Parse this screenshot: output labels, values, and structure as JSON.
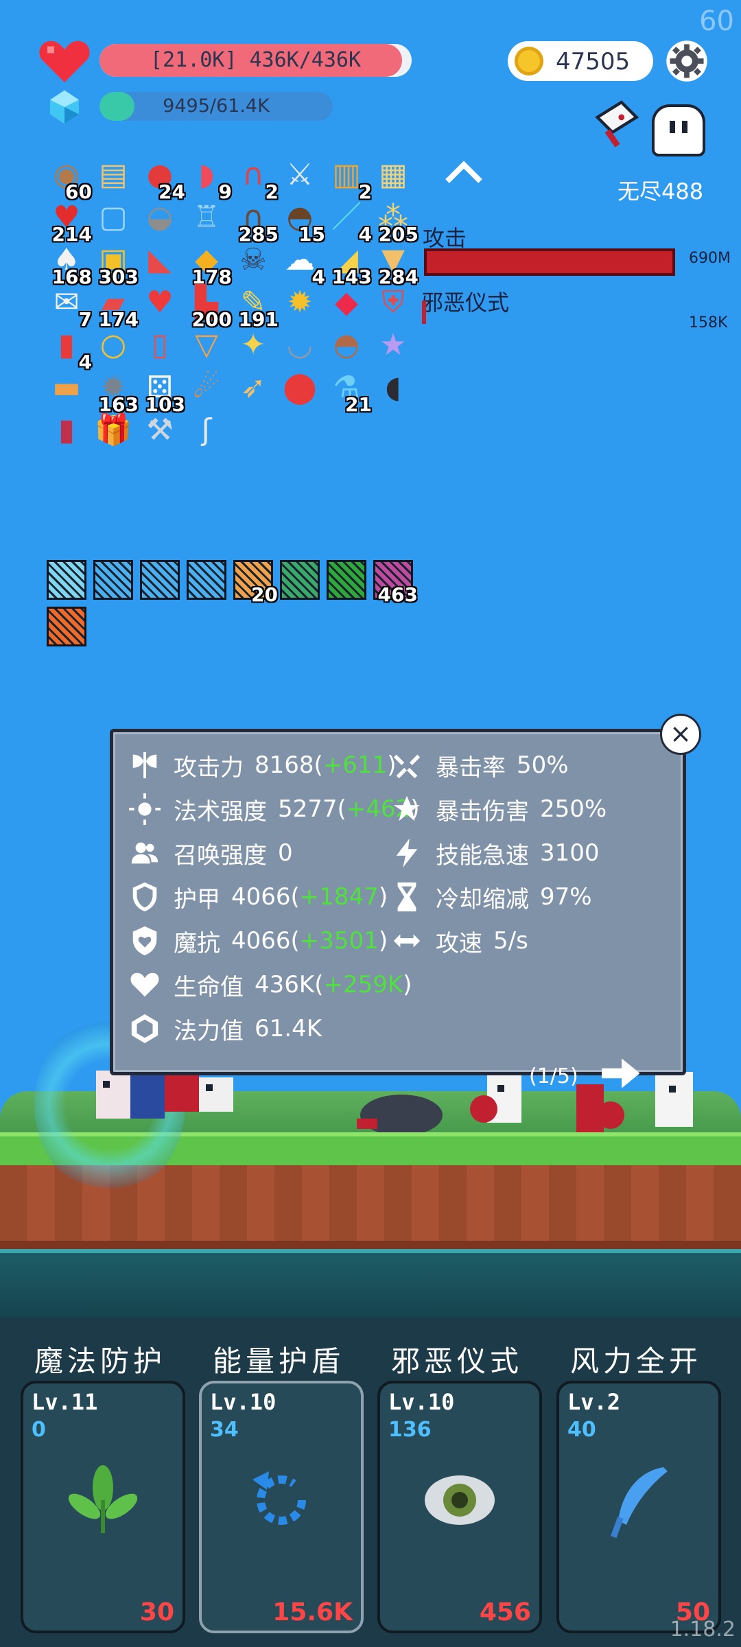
{
  "hud": {
    "fps": "60",
    "version": "1.18.2",
    "hp_text": "[21.0K] 436K/436K",
    "hp_fraction": 0.97,
    "mp_text": "9495/61.4K",
    "mp_fraction": 0.15,
    "gold": "47505",
    "stage": "无尽488"
  },
  "inventory": [
    {
      "name": "round-shield-item",
      "glyph": "◉",
      "color": "#b57a4a",
      "count": "60"
    },
    {
      "name": "scroll-item",
      "glyph": "▤",
      "color": "#f2c46a",
      "count": ""
    },
    {
      "name": "apple-item",
      "glyph": "●",
      "color": "#e33b3b",
      "count": "24"
    },
    {
      "name": "watermelon-item",
      "glyph": "◗",
      "color": "#ef4b5a",
      "count": "9"
    },
    {
      "name": "magnet-item",
      "glyph": "∩",
      "color": "#e0444a",
      "count": "2"
    },
    {
      "name": "sword-item",
      "glyph": "⚔",
      "color": "#dfe7ee",
      "count": ""
    },
    {
      "name": "book-item",
      "glyph": "▥",
      "color": "#f0a22f",
      "count": "2"
    },
    {
      "name": "map-item",
      "glyph": "▦",
      "color": "#f2d27a",
      "count": ""
    },
    {
      "name": "strawberry-item",
      "glyph": "♥",
      "color": "#e32c2c",
      "count": "214"
    },
    {
      "name": "empty-slot-item",
      "glyph": "▢",
      "color": "#9fd6f5",
      "count": ""
    },
    {
      "name": "helmet-item",
      "glyph": "◒",
      "color": "#8e8e8e",
      "count": ""
    },
    {
      "name": "shirt-item",
      "glyph": "♖",
      "color": "#9bd0f0",
      "count": ""
    },
    {
      "name": "tombstone-item",
      "glyph": "∩",
      "color": "#6a4a3a",
      "count": "285"
    },
    {
      "name": "coconut-item",
      "glyph": "◓",
      "color": "#6b4426",
      "count": "15"
    },
    {
      "name": "scalpel-item",
      "glyph": "／",
      "color": "#5fe0e0",
      "count": "4"
    },
    {
      "name": "grapes-item",
      "glyph": "⁂",
      "color": "#f0d070",
      "count": "205"
    },
    {
      "name": "cards-item",
      "glyph": "♠",
      "color": "#f2f2f2",
      "count": "168"
    },
    {
      "name": "toolbox-item",
      "glyph": "▣",
      "color": "#f4c02a",
      "count": "303"
    },
    {
      "name": "sneaker-item",
      "glyph": "◣",
      "color": "#e84a4a",
      "count": ""
    },
    {
      "name": "pineapple-item",
      "glyph": "◆",
      "color": "#f4b01e",
      "count": "178"
    },
    {
      "name": "skull-book-item",
      "glyph": "☠",
      "color": "#3a3f55",
      "count": ""
    },
    {
      "name": "ghost-item",
      "glyph": "☁",
      "color": "#ffffff",
      "count": "4"
    },
    {
      "name": "cheese-item",
      "glyph": "◢",
      "color": "#f6d24a",
      "count": "143"
    },
    {
      "name": "ice-cream-item",
      "glyph": "▼",
      "color": "#f2c06a",
      "count": "284"
    },
    {
      "name": "envelope-item",
      "glyph": "✉",
      "color": "#f2f2f2",
      "count": "7"
    },
    {
      "name": "pill-item",
      "glyph": "▰",
      "color": "#e84a4a",
      "count": "174"
    },
    {
      "name": "heart-item",
      "glyph": "♥",
      "color": "#ee3a3a",
      "count": ""
    },
    {
      "name": "boot-item",
      "glyph": "▙",
      "color": "#e83a3a",
      "count": "200"
    },
    {
      "name": "note-item",
      "glyph": "✎",
      "color": "#f6d24a",
      "count": "191"
    },
    {
      "name": "sun-item",
      "glyph": "✹",
      "color": "#f6c02a",
      "count": ""
    },
    {
      "name": "gem-item",
      "glyph": "◆",
      "color": "#ee2a4a",
      "count": ""
    },
    {
      "name": "crest-shield-item",
      "glyph": "⛨",
      "color": "#e84a4a",
      "count": ""
    },
    {
      "name": "bookmark-item",
      "glyph": "▮",
      "color": "#e83a3a",
      "count": "4"
    },
    {
      "name": "ring-item",
      "glyph": "○",
      "color": "#f6c02a",
      "count": ""
    },
    {
      "name": "thermometer-item",
      "glyph": "▯",
      "color": "#e85050",
      "count": ""
    },
    {
      "name": "cocktail-item",
      "glyph": "▽",
      "color": "#f2a04a",
      "count": ""
    },
    {
      "name": "magic-wand-item",
      "glyph": "✦",
      "color": "#f6d24a",
      "count": ""
    },
    {
      "name": "mortar-item",
      "glyph": "◡",
      "color": "#8e9aa6",
      "count": ""
    },
    {
      "name": "mushroom-item",
      "glyph": "◓",
      "color": "#b06a4a",
      "count": ""
    },
    {
      "name": "chest-item",
      "glyph": "★",
      "color": "#b89af0",
      "count": ""
    },
    {
      "name": "briefcase-item",
      "glyph": "▬",
      "color": "#f0a24a",
      "count": ""
    },
    {
      "name": "spiked-ball-item",
      "glyph": "✹",
      "color": "#7a8390",
      "count": "163"
    },
    {
      "name": "dice-item",
      "glyph": "⚄",
      "color": "#f2f2f2",
      "count": "103"
    },
    {
      "name": "meteor-item",
      "glyph": "☄",
      "color": "#f08a3a",
      "count": ""
    },
    {
      "name": "bow-item",
      "glyph": "➶",
      "color": "#f2c06a",
      "count": ""
    },
    {
      "name": "map-pin-item",
      "glyph": "⬤",
      "color": "#e83a3a",
      "count": ""
    },
    {
      "name": "potion-item",
      "glyph": "⚗",
      "color": "#6fd0f6",
      "count": "21"
    },
    {
      "name": "cauldron-item",
      "glyph": "◖",
      "color": "#2b2b33",
      "count": ""
    },
    {
      "name": "jam-jar-item",
      "glyph": "▮",
      "color": "#c0304a",
      "count": ""
    },
    {
      "name": "gift-item",
      "glyph": "🎁",
      "color": "#e83a3a",
      "count": ""
    },
    {
      "name": "battle-axe-item",
      "glyph": "⚒",
      "color": "#cfd6de",
      "count": ""
    },
    {
      "name": "hook-item",
      "glyph": "ʃ",
      "color": "#e8e8e8",
      "count": ""
    }
  ],
  "enemy": {
    "attack_label": "攻击",
    "attack_value": "690M",
    "ritual_label": "邪恶仪式",
    "ritual_value": "158K"
  },
  "runes": [
    {
      "name": "lightbulb-rune",
      "color": "#7fd6f0",
      "count": ""
    },
    {
      "name": "vortex-rune-1",
      "color": "#4ab0f0",
      "count": ""
    },
    {
      "name": "vortex-rune-2",
      "color": "#4ab0f0",
      "count": ""
    },
    {
      "name": "vortex-rune-3",
      "color": "#4ab0f0",
      "count": ""
    },
    {
      "name": "chest-rune",
      "color": "#f0a24a",
      "count": "20"
    },
    {
      "name": "invader-rune",
      "color": "#3aaa6a",
      "count": ""
    },
    {
      "name": "maze-rune",
      "color": "#2ea83a",
      "count": ""
    },
    {
      "name": "crown-rune",
      "color": "#c04aa0",
      "count": "463"
    },
    {
      "name": "fire-rune",
      "color": "#f06a2a",
      "count": ""
    }
  ],
  "stats_panel": {
    "close": "×",
    "left": [
      {
        "name": "attack-power",
        "icon": "axe-icon",
        "label": "攻击力",
        "value": "8168",
        "bonus": "+611"
      },
      {
        "name": "spell-power",
        "icon": "sun-icon",
        "label": "法术强度",
        "value": "5277",
        "bonus": "+462"
      },
      {
        "name": "summon-power",
        "icon": "people-icon",
        "label": "召唤强度",
        "value": "0",
        "bonus": ""
      },
      {
        "name": "armor",
        "icon": "shield-icon",
        "label": "护甲",
        "value": "4066",
        "bonus": "+1847"
      },
      {
        "name": "magic-resist",
        "icon": "heart-shield-icon",
        "label": "魔抗",
        "value": "4066",
        "bonus": "+3501"
      },
      {
        "name": "health",
        "icon": "heart-icon",
        "label": "生命值",
        "value": "436K",
        "bonus": "+259K"
      },
      {
        "name": "mana",
        "icon": "hexagon-icon",
        "label": "法力值",
        "value": "61.4K",
        "bonus": ""
      }
    ],
    "right": [
      {
        "name": "crit-rate",
        "icon": "crit-icon",
        "label": "暴击率",
        "value": "50%"
      },
      {
        "name": "crit-damage",
        "icon": "crit-damage-icon",
        "label": "暴击伤害",
        "value": "250%"
      },
      {
        "name": "skill-haste",
        "icon": "lightning-icon",
        "label": "技能急速",
        "value": "3100"
      },
      {
        "name": "cooldown-reduction",
        "icon": "hourglass-icon",
        "label": "冷却缩减",
        "value": "97%"
      },
      {
        "name": "attack-speed",
        "icon": "arrows-icon",
        "label": "攻速",
        "value": "5/s"
      }
    ],
    "page": "(1/5)"
  },
  "skills": [
    {
      "name": "magic-protection",
      "title": "魔法防护",
      "level": "Lv.11",
      "value": "0",
      "cost": "30",
      "icon": "leaf-icon",
      "selected": false
    },
    {
      "name": "energy-shield",
      "title": "能量护盾",
      "level": "Lv.10",
      "value": "34",
      "cost": "15.6K",
      "icon": "refresh-icon",
      "selected": true
    },
    {
      "name": "evil-ritual",
      "title": "邪恶仪式",
      "level": "Lv.10",
      "value": "136",
      "cost": "456",
      "icon": "eye-icon",
      "selected": false
    },
    {
      "name": "full-wind",
      "title": "风力全开",
      "level": "Lv.2",
      "value": "40",
      "cost": "50",
      "icon": "feather-icon",
      "selected": false
    }
  ]
}
